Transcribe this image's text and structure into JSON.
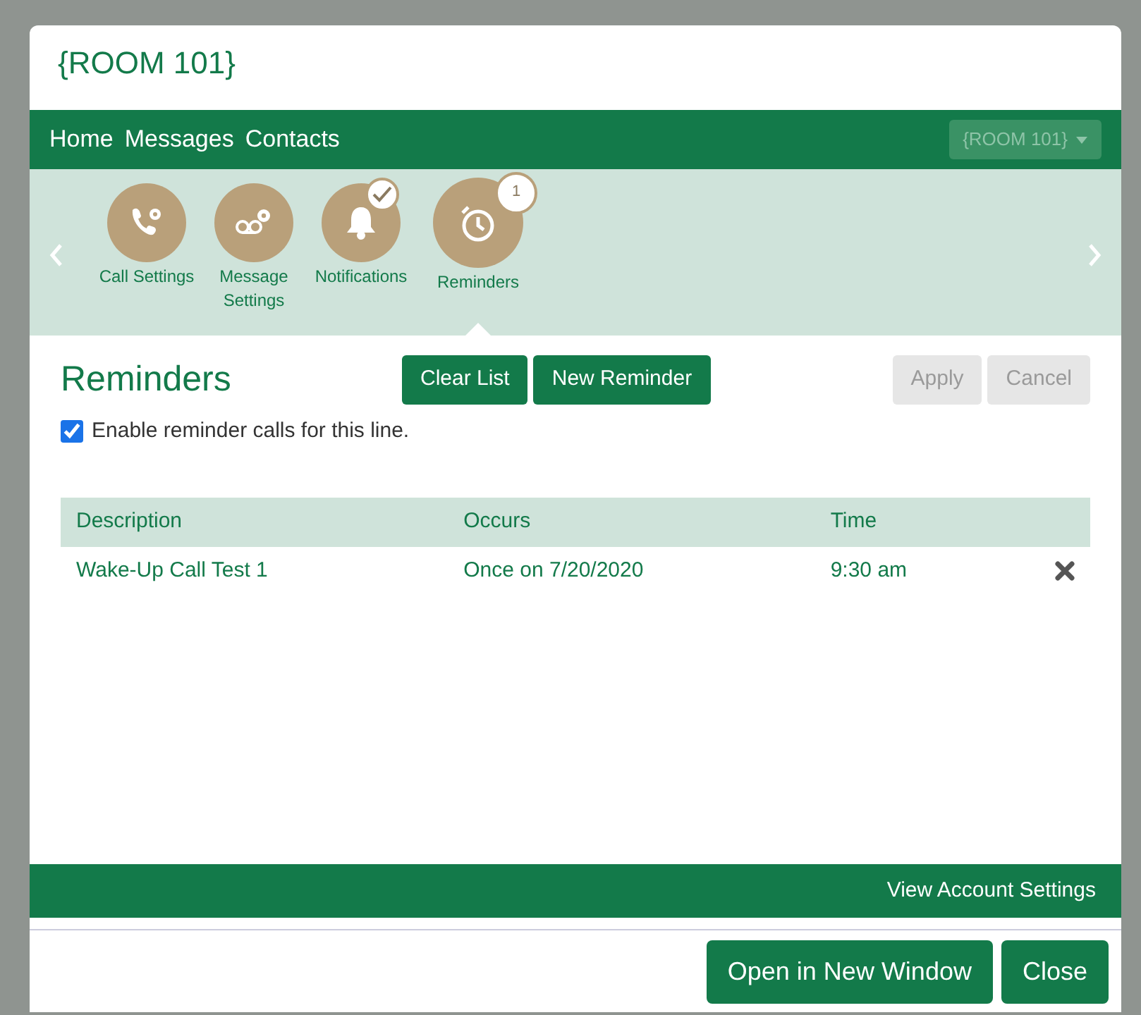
{
  "window": {
    "title": "{ROOM 101}"
  },
  "nav": {
    "links": [
      {
        "label": "Home"
      },
      {
        "label": "Messages"
      },
      {
        "label": "Contacts"
      }
    ],
    "line_select": "{ROOM 101}"
  },
  "features": [
    {
      "label": "Call Settings",
      "kind": "call",
      "selected": false,
      "checked": false
    },
    {
      "label": "Message Settings",
      "kind": "message",
      "selected": false,
      "checked": false
    },
    {
      "label": "Notifications",
      "kind": "bell",
      "selected": false,
      "checked": true
    },
    {
      "label": "Reminders",
      "kind": "timer",
      "selected": true,
      "checked": false,
      "count": "1"
    }
  ],
  "panel": {
    "title": "Reminders",
    "buttons": [
      {
        "label": "Clear List",
        "disabled": false
      },
      {
        "label": "New Reminder",
        "disabled": false
      }
    ],
    "actions": [
      {
        "label": "Apply",
        "disabled": true
      },
      {
        "label": "Cancel",
        "disabled": true
      }
    ],
    "enable": {
      "label": "Enable reminder calls for this line.",
      "checked": true
    }
  },
  "table": {
    "columns": [
      "Description",
      "Occurs",
      "Time"
    ],
    "rows": [
      {
        "description": "Wake-Up Call Test 1",
        "occurs": "Once on 7/20/2020",
        "time": "9:30 am"
      }
    ]
  },
  "footer_link": "View Account Settings",
  "buttons": [
    {
      "label": "Open in New Window"
    },
    {
      "label": "Close"
    }
  ]
}
